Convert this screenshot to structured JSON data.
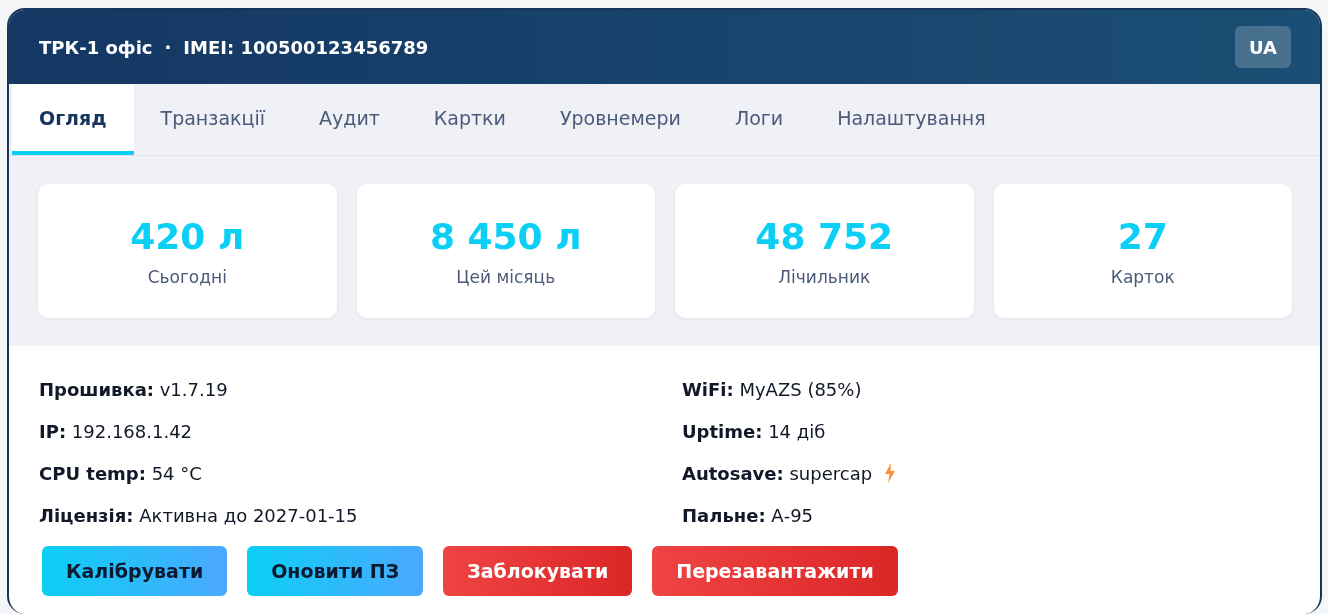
{
  "header": {
    "title": "ТРК-1 офіс",
    "separator": "·",
    "imei": "IMEI: 100500123456789",
    "language_button": "UA"
  },
  "tabs": [
    {
      "label": "Огляд",
      "selected": true
    },
    {
      "label": "Транзакції",
      "selected": false
    },
    {
      "label": "Аудит",
      "selected": false
    },
    {
      "label": "Картки",
      "selected": false
    },
    {
      "label": "Уровнемери",
      "selected": false
    },
    {
      "label": "Логи",
      "selected": false
    },
    {
      "label": "Налаштування",
      "selected": false
    }
  ],
  "stats": [
    {
      "value": "420 л",
      "label": "Сьогодні"
    },
    {
      "value": "8 450 л",
      "label": "Цей місяць"
    },
    {
      "value": "48 752",
      "label": "Лічильник"
    },
    {
      "value": "27",
      "label": "Карток"
    }
  ],
  "info_left": [
    {
      "kind": "plain",
      "text": "**Прошивка:** v1.7.19"
    },
    {
      "kind": "plain",
      "text": "**IP:** 192.168.1.42"
    },
    {
      "kind": "plain",
      "text": "**CPU temp:** 54 °C"
    },
    {
      "kind": "plain",
      "text": "**Ліцензія:** Активна до 2027-01-15"
    }
  ],
  "info_right": [
    {
      "kind": "plain",
      "text": "**WiFi:** MyAZS (85%)"
    },
    {
      "kind": "plain",
      "text": "**Uptime:** 14 діб"
    },
    {
      "kind": "lightning",
      "text": "**Autosave:** supercap"
    },
    {
      "kind": "plain",
      "text": "**Пальне:** А-95"
    }
  ],
  "buttons": [
    {
      "label": "Калібрувати",
      "kind": "primary"
    },
    {
      "label": "Оновити ПЗ",
      "kind": "primary"
    },
    {
      "label": "Заблокувати",
      "kind": "danger"
    },
    {
      "label": "Перезавантажити",
      "kind": "danger"
    }
  ]
}
